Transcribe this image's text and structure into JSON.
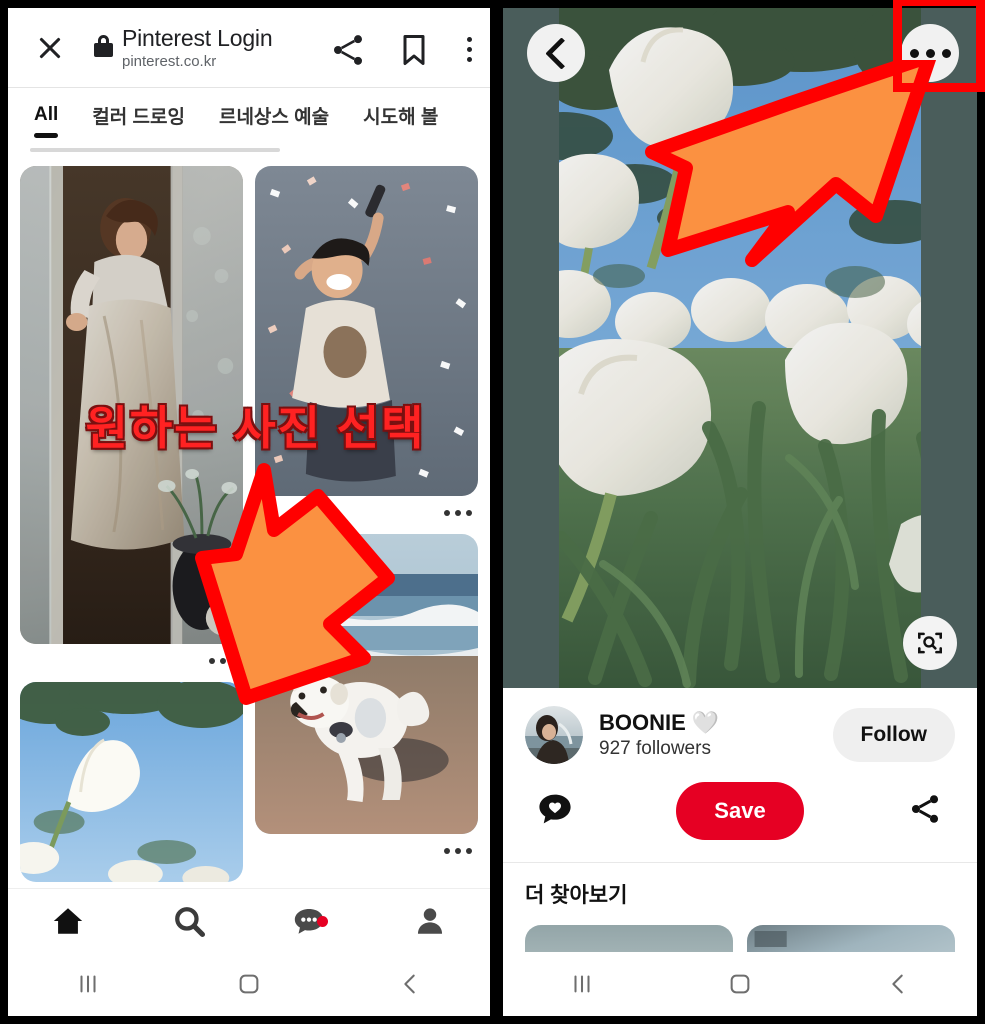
{
  "browser": {
    "title": "Pinterest Login",
    "url": "pinterest.co.kr",
    "close_icon": "close-x-icon",
    "lock_icon": "lock-icon",
    "share_icon": "share-icon",
    "bookmark_icon": "bookmark-icon",
    "menu_icon": "kebab-menu-icon"
  },
  "tabs": [
    {
      "label": "All",
      "active": true
    },
    {
      "label": "컬러 드로잉",
      "active": false
    },
    {
      "label": "르네상스 예술",
      "active": false
    },
    {
      "label": "시도해 볼",
      "active": false
    }
  ],
  "grid": {
    "pins": [
      {
        "id": "pin-painting-woman",
        "alt": "여인 그림",
        "overflow": "…"
      },
      {
        "id": "pin-confetti-performer",
        "alt": "공연 사진",
        "overflow": "…"
      },
      {
        "id": "pin-tulip-sky",
        "alt": "튤립 하늘",
        "overflow": "…"
      },
      {
        "id": "pin-dog-beach",
        "alt": "해변 강아지 그림",
        "overflow": "…"
      }
    ]
  },
  "bottom_nav": [
    {
      "name": "home",
      "icon": "home-icon",
      "active": true,
      "badge": false
    },
    {
      "name": "search",
      "icon": "search-icon",
      "active": false,
      "badge": false
    },
    {
      "name": "messages",
      "icon": "chat-bubble-icon",
      "active": false,
      "badge": true
    },
    {
      "name": "profile",
      "icon": "person-icon",
      "active": false,
      "badge": false
    }
  ],
  "detail": {
    "back_icon": "back-chevron-icon",
    "more_icon": "more-dots-icon",
    "lens_icon": "visual-search-icon",
    "creator_name": "BOONIE",
    "creator_emoji": "🤍",
    "followers": "927 followers",
    "follow_label": "Follow",
    "comment_icon": "heart-comment-icon",
    "save_label": "Save",
    "share_icon": "share-icon",
    "explore_title": "더 찾아보기"
  },
  "sysnav": {
    "recents": "recents-button",
    "home": "home-button",
    "back": "back-button"
  },
  "annotations": {
    "overlay_text": "원하는 사진 선택",
    "highlight_color": "#ff0000",
    "arrow_fill": "#fb9141",
    "arrow_stroke": "#ff0000"
  },
  "colors": {
    "brand_red": "#e60023",
    "hero_letterbox": "#4a5d5b",
    "chrome_text": "#202124",
    "url_text": "#5f6368"
  }
}
